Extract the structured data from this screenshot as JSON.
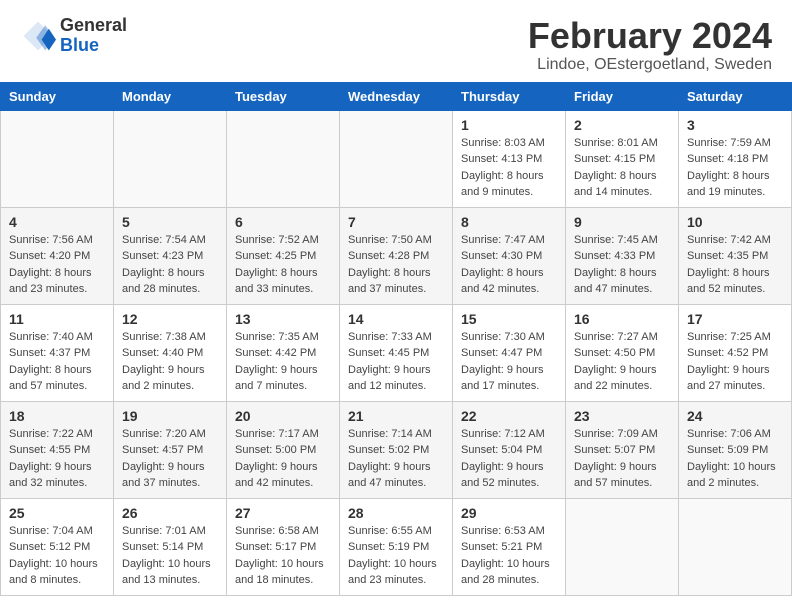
{
  "logo": {
    "general": "General",
    "blue": "Blue"
  },
  "title": "February 2024",
  "subtitle": "Lindoe, OEstergoetland, Sweden",
  "weekdays": [
    "Sunday",
    "Monday",
    "Tuesday",
    "Wednesday",
    "Thursday",
    "Friday",
    "Saturday"
  ],
  "weeks": [
    [
      {
        "day": "",
        "detail": ""
      },
      {
        "day": "",
        "detail": ""
      },
      {
        "day": "",
        "detail": ""
      },
      {
        "day": "",
        "detail": ""
      },
      {
        "day": "1",
        "detail": "Sunrise: 8:03 AM\nSunset: 4:13 PM\nDaylight: 8 hours\nand 9 minutes."
      },
      {
        "day": "2",
        "detail": "Sunrise: 8:01 AM\nSunset: 4:15 PM\nDaylight: 8 hours\nand 14 minutes."
      },
      {
        "day": "3",
        "detail": "Sunrise: 7:59 AM\nSunset: 4:18 PM\nDaylight: 8 hours\nand 19 minutes."
      }
    ],
    [
      {
        "day": "4",
        "detail": "Sunrise: 7:56 AM\nSunset: 4:20 PM\nDaylight: 8 hours\nand 23 minutes."
      },
      {
        "day": "5",
        "detail": "Sunrise: 7:54 AM\nSunset: 4:23 PM\nDaylight: 8 hours\nand 28 minutes."
      },
      {
        "day": "6",
        "detail": "Sunrise: 7:52 AM\nSunset: 4:25 PM\nDaylight: 8 hours\nand 33 minutes."
      },
      {
        "day": "7",
        "detail": "Sunrise: 7:50 AM\nSunset: 4:28 PM\nDaylight: 8 hours\nand 37 minutes."
      },
      {
        "day": "8",
        "detail": "Sunrise: 7:47 AM\nSunset: 4:30 PM\nDaylight: 8 hours\nand 42 minutes."
      },
      {
        "day": "9",
        "detail": "Sunrise: 7:45 AM\nSunset: 4:33 PM\nDaylight: 8 hours\nand 47 minutes."
      },
      {
        "day": "10",
        "detail": "Sunrise: 7:42 AM\nSunset: 4:35 PM\nDaylight: 8 hours\nand 52 minutes."
      }
    ],
    [
      {
        "day": "11",
        "detail": "Sunrise: 7:40 AM\nSunset: 4:37 PM\nDaylight: 8 hours\nand 57 minutes."
      },
      {
        "day": "12",
        "detail": "Sunrise: 7:38 AM\nSunset: 4:40 PM\nDaylight: 9 hours\nand 2 minutes."
      },
      {
        "day": "13",
        "detail": "Sunrise: 7:35 AM\nSunset: 4:42 PM\nDaylight: 9 hours\nand 7 minutes."
      },
      {
        "day": "14",
        "detail": "Sunrise: 7:33 AM\nSunset: 4:45 PM\nDaylight: 9 hours\nand 12 minutes."
      },
      {
        "day": "15",
        "detail": "Sunrise: 7:30 AM\nSunset: 4:47 PM\nDaylight: 9 hours\nand 17 minutes."
      },
      {
        "day": "16",
        "detail": "Sunrise: 7:27 AM\nSunset: 4:50 PM\nDaylight: 9 hours\nand 22 minutes."
      },
      {
        "day": "17",
        "detail": "Sunrise: 7:25 AM\nSunset: 4:52 PM\nDaylight: 9 hours\nand 27 minutes."
      }
    ],
    [
      {
        "day": "18",
        "detail": "Sunrise: 7:22 AM\nSunset: 4:55 PM\nDaylight: 9 hours\nand 32 minutes."
      },
      {
        "day": "19",
        "detail": "Sunrise: 7:20 AM\nSunset: 4:57 PM\nDaylight: 9 hours\nand 37 minutes."
      },
      {
        "day": "20",
        "detail": "Sunrise: 7:17 AM\nSunset: 5:00 PM\nDaylight: 9 hours\nand 42 minutes."
      },
      {
        "day": "21",
        "detail": "Sunrise: 7:14 AM\nSunset: 5:02 PM\nDaylight: 9 hours\nand 47 minutes."
      },
      {
        "day": "22",
        "detail": "Sunrise: 7:12 AM\nSunset: 5:04 PM\nDaylight: 9 hours\nand 52 minutes."
      },
      {
        "day": "23",
        "detail": "Sunrise: 7:09 AM\nSunset: 5:07 PM\nDaylight: 9 hours\nand 57 minutes."
      },
      {
        "day": "24",
        "detail": "Sunrise: 7:06 AM\nSunset: 5:09 PM\nDaylight: 10 hours\nand 2 minutes."
      }
    ],
    [
      {
        "day": "25",
        "detail": "Sunrise: 7:04 AM\nSunset: 5:12 PM\nDaylight: 10 hours\nand 8 minutes."
      },
      {
        "day": "26",
        "detail": "Sunrise: 7:01 AM\nSunset: 5:14 PM\nDaylight: 10 hours\nand 13 minutes."
      },
      {
        "day": "27",
        "detail": "Sunrise: 6:58 AM\nSunset: 5:17 PM\nDaylight: 10 hours\nand 18 minutes."
      },
      {
        "day": "28",
        "detail": "Sunrise: 6:55 AM\nSunset: 5:19 PM\nDaylight: 10 hours\nand 23 minutes."
      },
      {
        "day": "29",
        "detail": "Sunrise: 6:53 AM\nSunset: 5:21 PM\nDaylight: 10 hours\nand 28 minutes."
      },
      {
        "day": "",
        "detail": ""
      },
      {
        "day": "",
        "detail": ""
      }
    ]
  ]
}
